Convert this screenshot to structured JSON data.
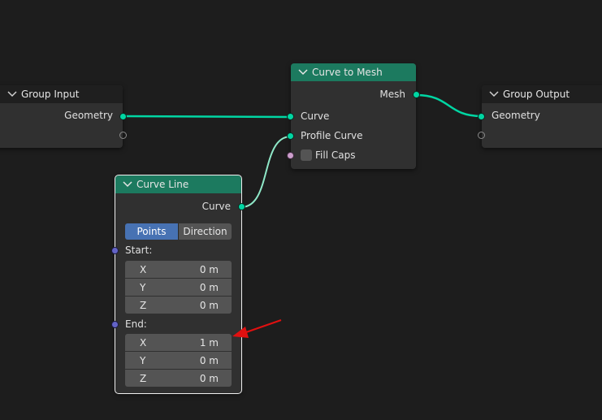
{
  "nodes": {
    "group_input": {
      "title": "Group Input",
      "outputs": [
        "Geometry"
      ]
    },
    "curve_to_mesh": {
      "title": "Curve to Mesh",
      "outputs": [
        "Mesh"
      ],
      "inputs": [
        "Curve",
        "Profile Curve"
      ],
      "fill_caps_label": "Fill Caps",
      "fill_caps_checked": false
    },
    "group_output": {
      "title": "Group Output",
      "inputs": [
        "Geometry"
      ]
    },
    "curve_line": {
      "title": "Curve Line",
      "outputs": [
        "Curve"
      ],
      "mode_options": [
        "Points",
        "Direction"
      ],
      "mode_selected": "Points",
      "start_label": "Start:",
      "start": [
        {
          "axis": "X",
          "value": "0 m"
        },
        {
          "axis": "Y",
          "value": "0 m"
        },
        {
          "axis": "Z",
          "value": "0 m"
        }
      ],
      "end_label": "End:",
      "end": [
        {
          "axis": "X",
          "value": "1 m"
        },
        {
          "axis": "Y",
          "value": "0 m"
        },
        {
          "axis": "Z",
          "value": "0 m"
        }
      ]
    }
  },
  "colors": {
    "background": "#1d1d1d",
    "node_body": "#303030",
    "geometry_header": "#1c7a5f",
    "geometry_socket": "#00d6a3",
    "vector_socket": "#6363c7",
    "boolean_socket": "#cc9ecc",
    "active_button": "#4772b3",
    "annotation_arrow": "#e01010"
  }
}
